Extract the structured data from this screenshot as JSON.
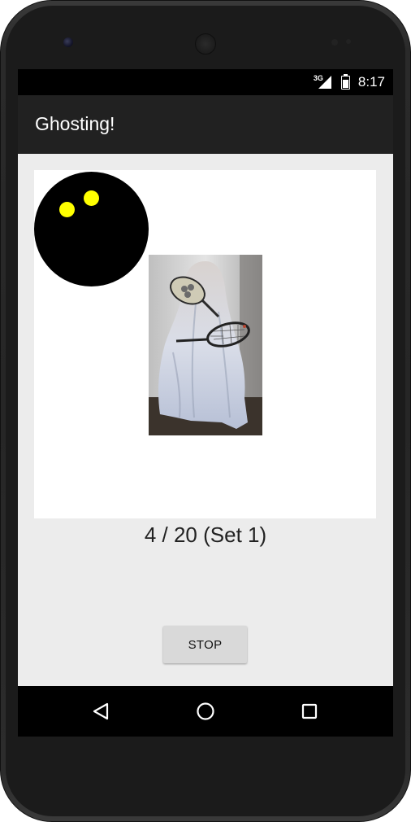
{
  "status_bar": {
    "network": "3G",
    "time": "8:17",
    "battery_level": 0.8
  },
  "app_bar": {
    "title": "Ghosting!"
  },
  "game": {
    "ball_color": "#000000",
    "dot_color": "#ffff00",
    "image_icon": "ghost-with-rackets-image"
  },
  "counter": {
    "text": "4 / 20 (Set 1)"
  },
  "controls": {
    "stop_label": "STOP"
  },
  "nav_bar": {
    "back_icon": "back-triangle-icon",
    "home_icon": "home-circle-icon",
    "recents_icon": "recents-square-icon"
  },
  "colors": {
    "app_bar": "#212121",
    "status_bar": "#000000",
    "background": "#ececec",
    "button": "#d9d9d9"
  }
}
